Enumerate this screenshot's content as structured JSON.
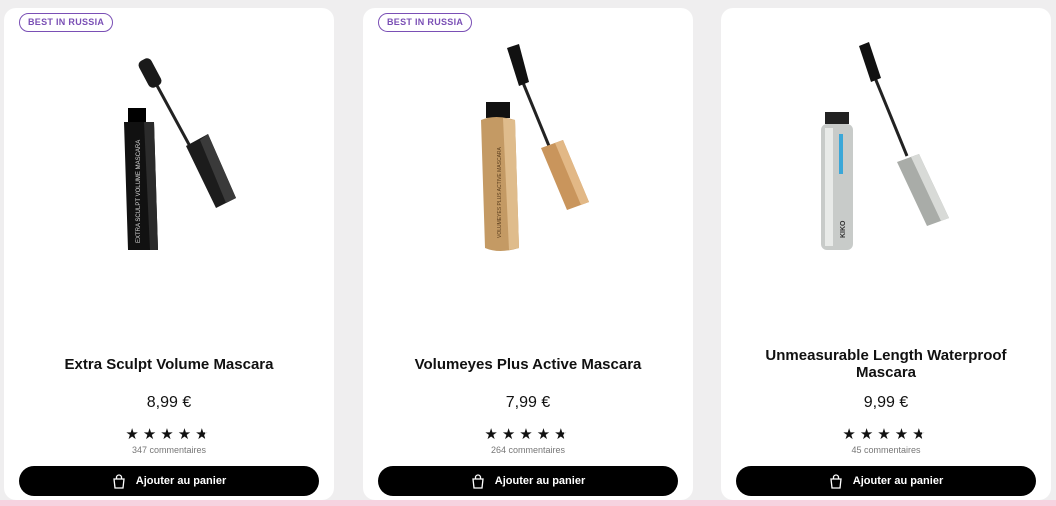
{
  "products": [
    {
      "badge": "BEST IN RUSSIA",
      "title": "Extra Sculpt Volume Mascara",
      "price": "8,99 €",
      "rating": 4.5,
      "reviews": "347 commentaires",
      "cta": "Ajouter au panier",
      "image_icon": "black-mascara-image",
      "tube_text": "EXTRA SCULPT VOLUME MASCARA",
      "colors": {
        "tube": "#111111",
        "cap": "#1c1c1c"
      }
    },
    {
      "badge": "BEST IN RUSSIA",
      "title": "Volumeyes Plus Active Mascara",
      "price": "7,99 €",
      "rating": 4.5,
      "reviews": "264 commentaires",
      "cta": "Ajouter au panier",
      "image_icon": "gold-mascara-image",
      "tube_text": "VOLUMEYES PLUS ACTIVE MASCARA",
      "colors": {
        "tube": "#c49a64",
        "cap": "#c9955c"
      }
    },
    {
      "badge": "",
      "title": "Unmeasurable Length Waterproof Mascara",
      "price": "9,99 €",
      "rating": 4.5,
      "reviews": "45 commentaires",
      "cta": "Ajouter au panier",
      "image_icon": "silver-mascara-image",
      "tube_text": "KIKO",
      "colors": {
        "tube": "#c8cbc9",
        "cap": "#a9aca8"
      }
    }
  ],
  "theme": {
    "badge_color": "#7a4fb5",
    "button_bg": "#000000",
    "page_bg": "#efeeef",
    "accent_strip": "#f6d3e0"
  }
}
